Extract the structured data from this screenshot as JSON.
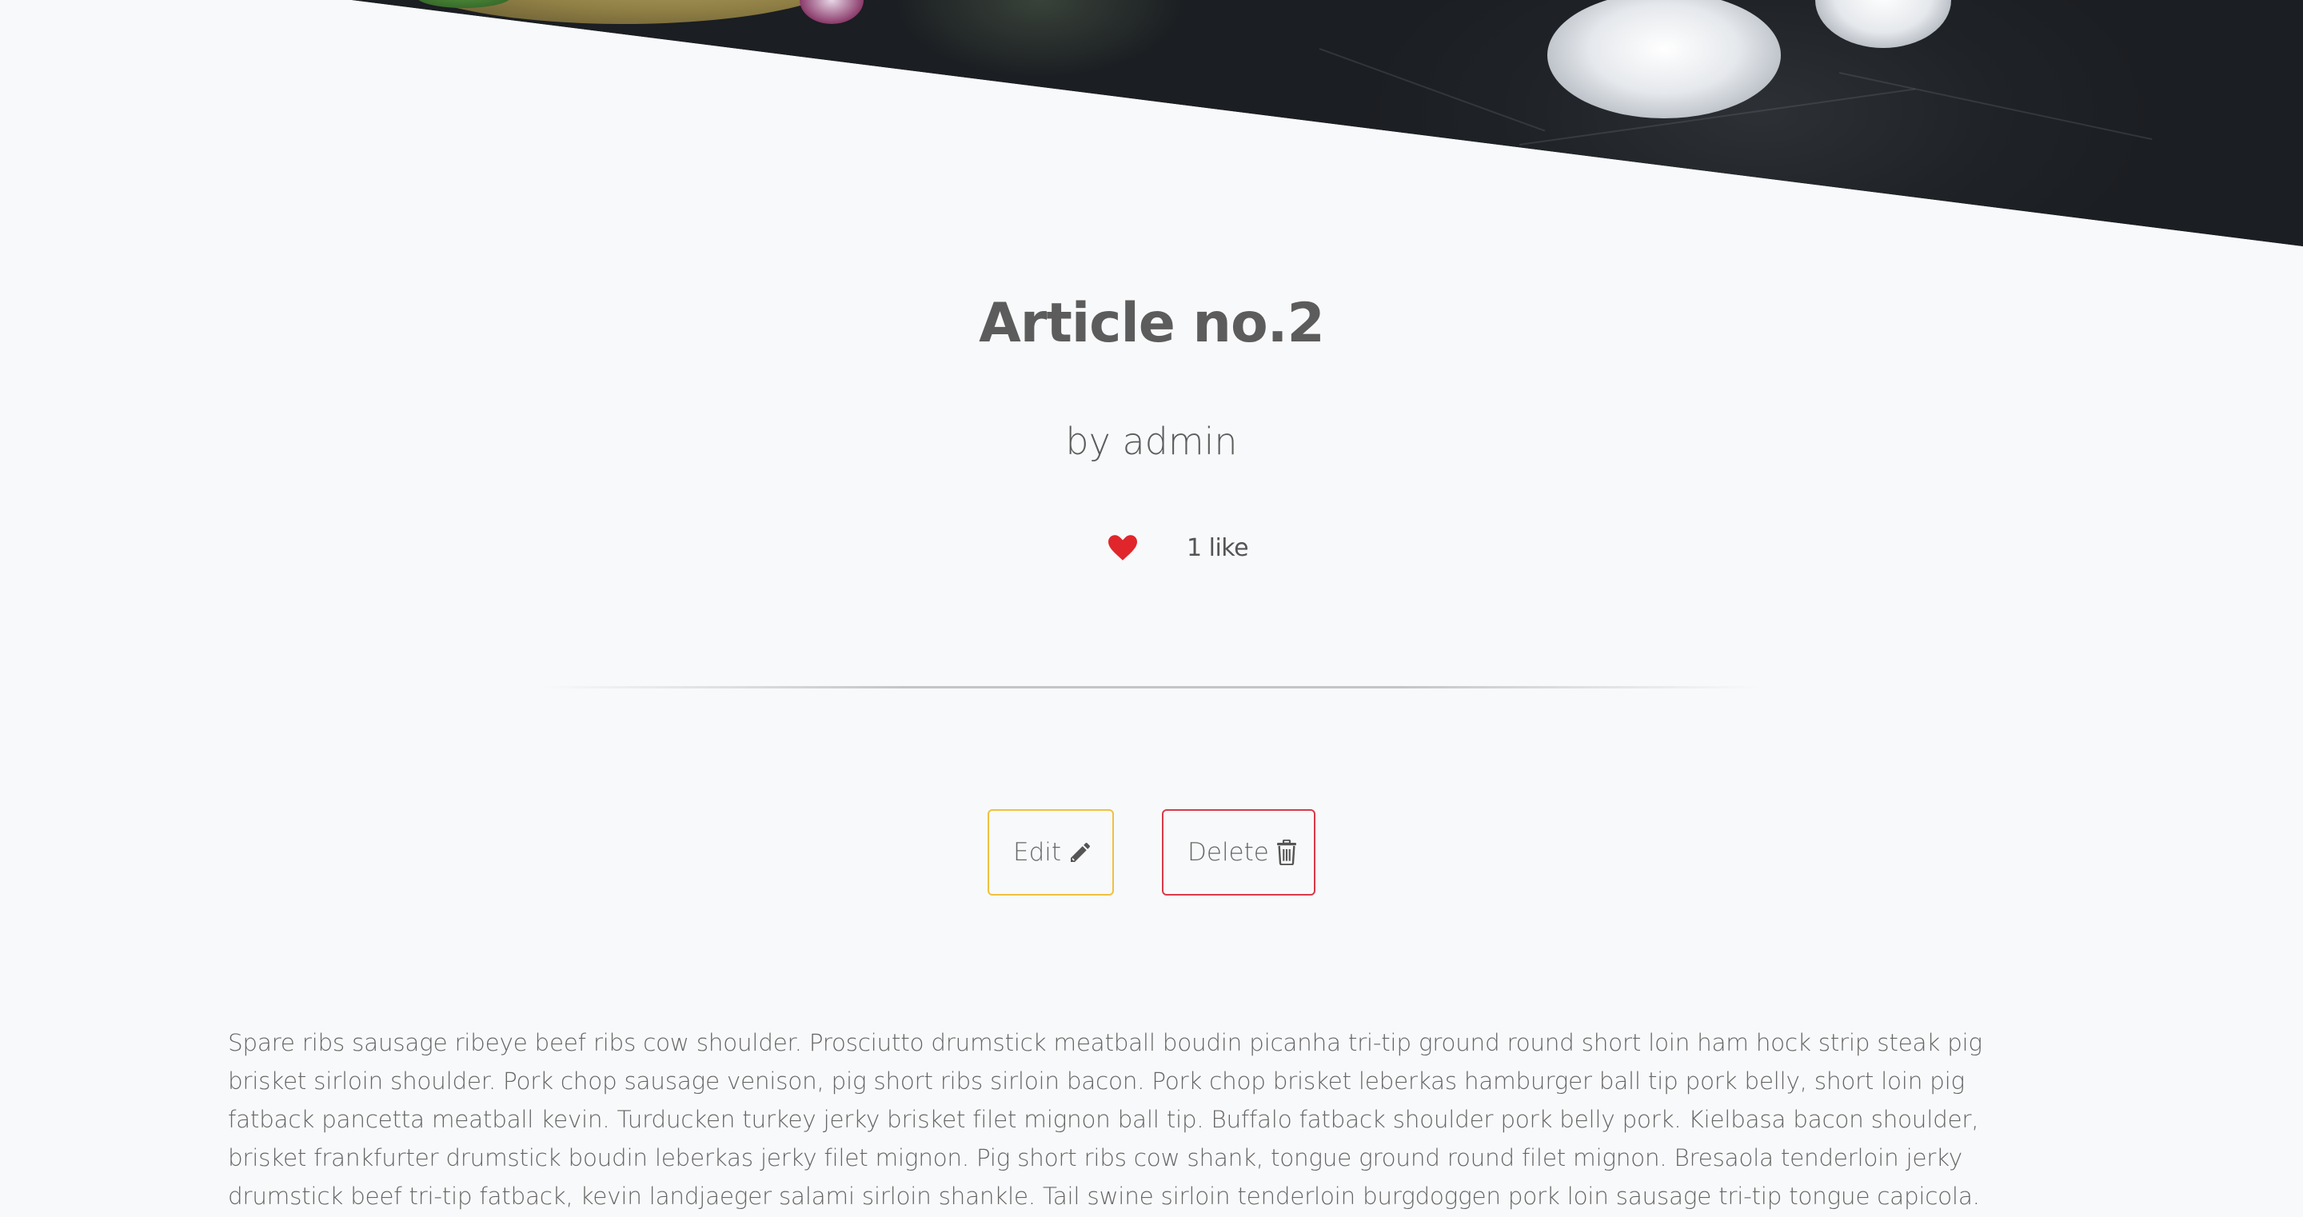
{
  "hero": {
    "image_alt": "food photo on slate"
  },
  "article": {
    "title": "Article no.2",
    "author_line": "by admin",
    "likes_label": "1 like",
    "body": "Spare ribs sausage ribeye beef ribs cow shoulder. Prosciutto drumstick meatball boudin picanha tri-tip ground round short loin ham hock strip steak pig brisket sirloin shoulder. Pork chop sausage venison, pig short ribs sirloin bacon. Pork chop brisket leberkas hamburger ball tip pork belly, short loin pig fatback pancetta meatball kevin. Turducken turkey jerky brisket filet mignon ball tip. Buffalo fatback shoulder pork belly pork. Kielbasa bacon shoulder, brisket frankfurter drumstick boudin leberkas jerky filet mignon. Pig short ribs cow shank, tongue ground round filet mignon. Bresaola tenderloin jerky drumstick beef tri-tip fatback, kevin landjaeger salami sirloin shankle. Tail swine sirloin tenderloin burgdoggen pork loin sausage tri-tip tongue capicola. Ribeye spare ribs sirloin, short loin biltong"
  },
  "actions": {
    "edit_label": "Edit",
    "delete_label": "Delete"
  },
  "icons": {
    "heart": "heart-icon",
    "edit": "pencil-icon",
    "delete": "trash-icon"
  },
  "colors": {
    "background": "#f8f9fa",
    "heart": "#e0262b",
    "edit_border": "#f0c040",
    "delete_border": "#d9394a",
    "text": "#5c5c5c"
  }
}
